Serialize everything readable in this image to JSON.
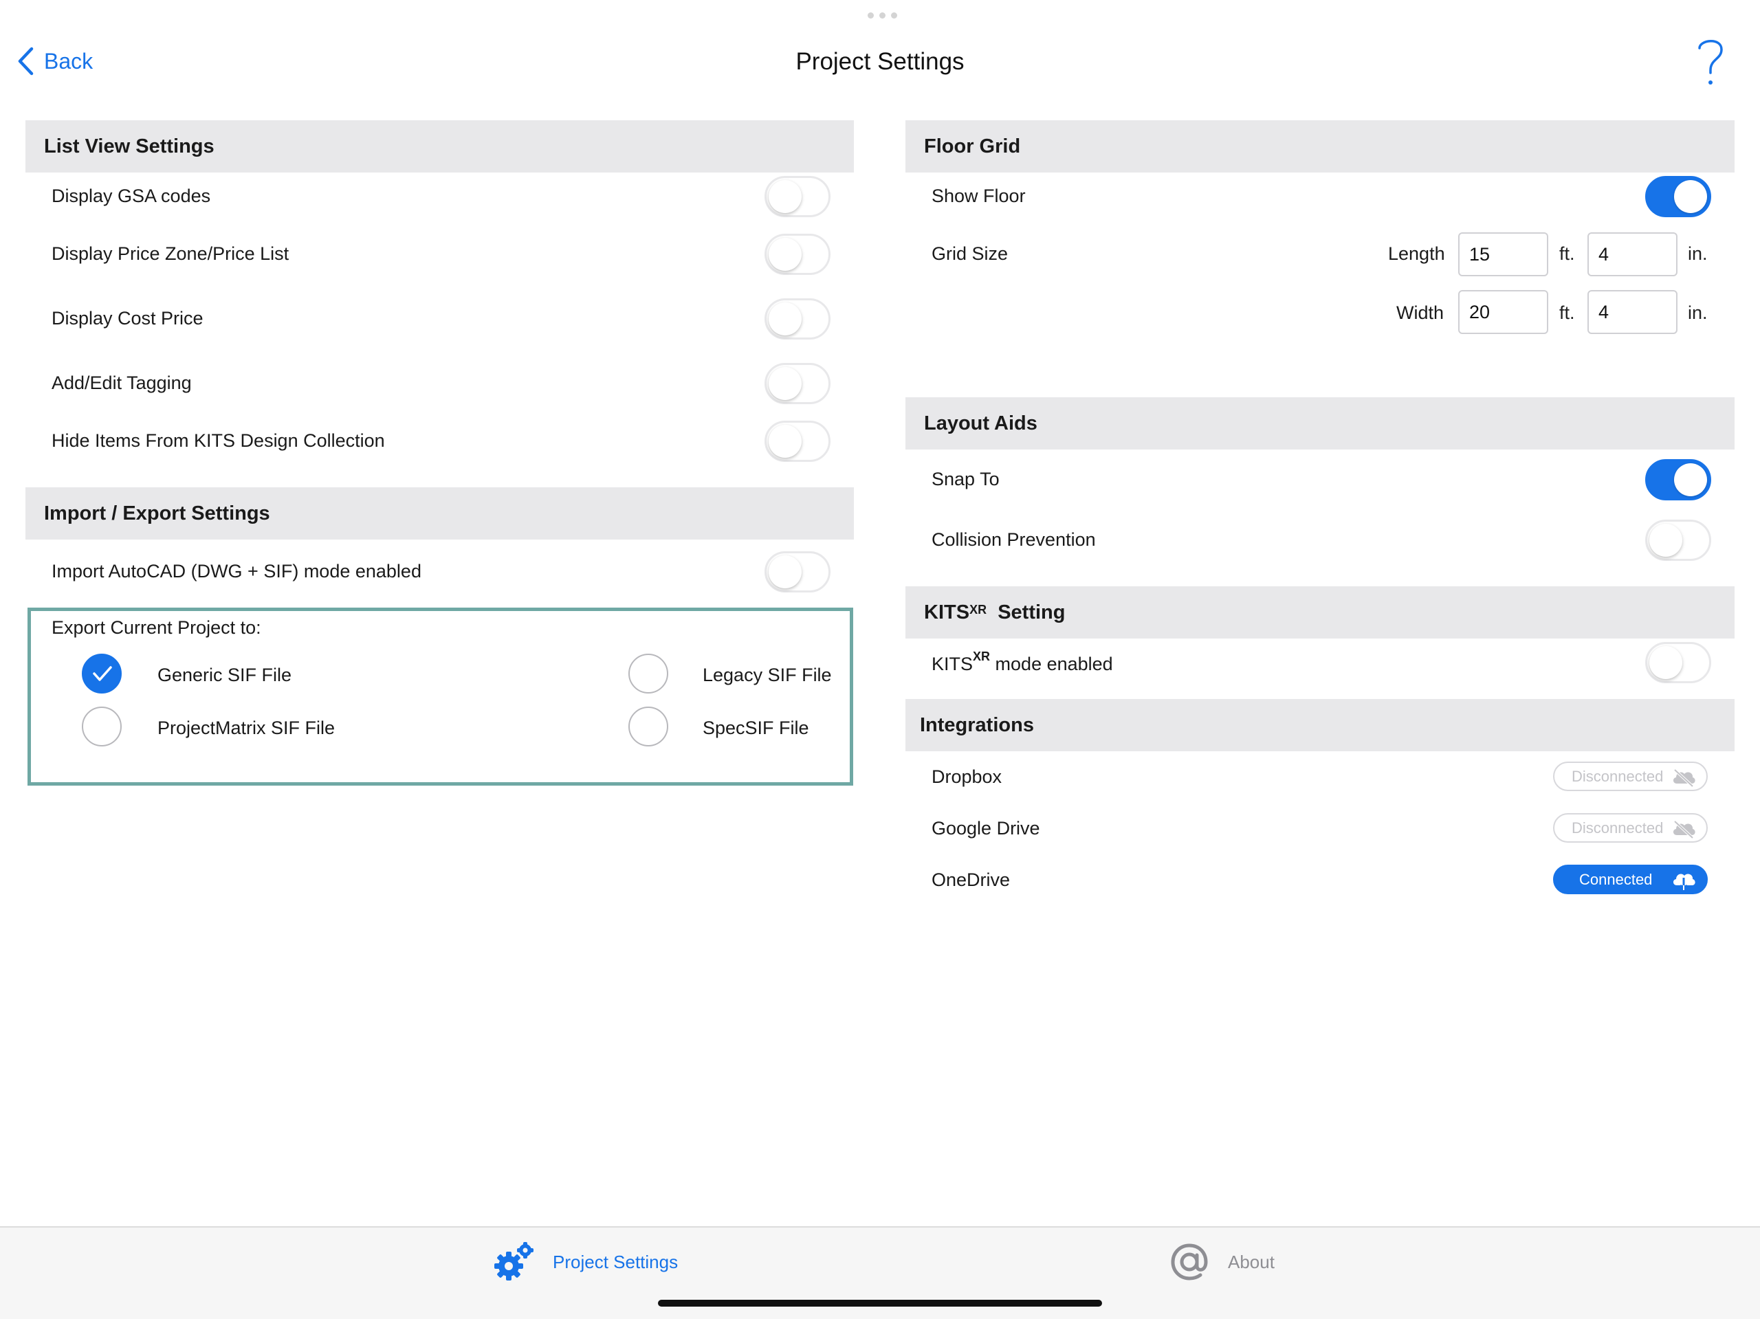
{
  "header": {
    "back_label": "Back",
    "title": "Project Settings",
    "help_icon": "question-mark-icon"
  },
  "list_view": {
    "title": "List View Settings",
    "items": [
      {
        "label": "Display GSA codes",
        "on": false
      },
      {
        "label": "Display Price Zone/Price List",
        "on": false
      },
      {
        "label": "Display Cost Price",
        "on": false
      },
      {
        "label": "Add/Edit Tagging",
        "on": false
      },
      {
        "label": "Hide Items From KITS Design Collection",
        "on": false
      }
    ]
  },
  "import_export": {
    "title": "Import / Export Settings",
    "import_label": "Import AutoCAD (DWG + SIF) mode enabled",
    "import_on": false,
    "export_title": "Export Current Project to:",
    "options": [
      {
        "label": "Generic SIF File",
        "checked": true
      },
      {
        "label": "Legacy SIF File",
        "checked": false
      },
      {
        "label": "ProjectMatrix SIF File",
        "checked": false
      },
      {
        "label": "SpecSIF File",
        "checked": false
      }
    ]
  },
  "floor_grid": {
    "title": "Floor Grid",
    "show_floor_label": "Show Floor",
    "show_floor_on": true,
    "grid_size_label": "Grid Size",
    "length_label": "Length",
    "width_label": "Width",
    "length_ft": "15",
    "length_in": "4",
    "width_ft": "20",
    "width_in": "4",
    "ft_unit": "ft.",
    "in_unit": "in."
  },
  "layout_aids": {
    "title": "Layout Aids",
    "snap_label": "Snap To",
    "snap_on": true,
    "collision_label": "Collision Prevention",
    "collision_on": false
  },
  "kits_xr": {
    "title_main": "KITS",
    "title_sup": "XR",
    "title_rest": "Setting",
    "mode_main": "KITS",
    "mode_sup": "XR",
    "mode_rest": "mode enabled",
    "mode_on": false
  },
  "integrations": {
    "title": "Integrations",
    "items": [
      {
        "label": "Dropbox",
        "status": "Disconnected",
        "icon": "cloud-off-icon"
      },
      {
        "label": "Google Drive",
        "status": "Disconnected",
        "icon": "cloud-off-icon"
      },
      {
        "label": "OneDrive",
        "status": "Connected",
        "icon": "cloud-download-icon"
      }
    ]
  },
  "tabbar": {
    "tabs": [
      {
        "label": "Project Settings",
        "icon": "gear-icon",
        "active": true
      },
      {
        "label": "About",
        "icon": "at-sign-icon",
        "active": false
      }
    ]
  },
  "colors": {
    "accent": "#1773e8",
    "section_bg": "#e8e8ea",
    "export_border": "#6fa8a4"
  }
}
